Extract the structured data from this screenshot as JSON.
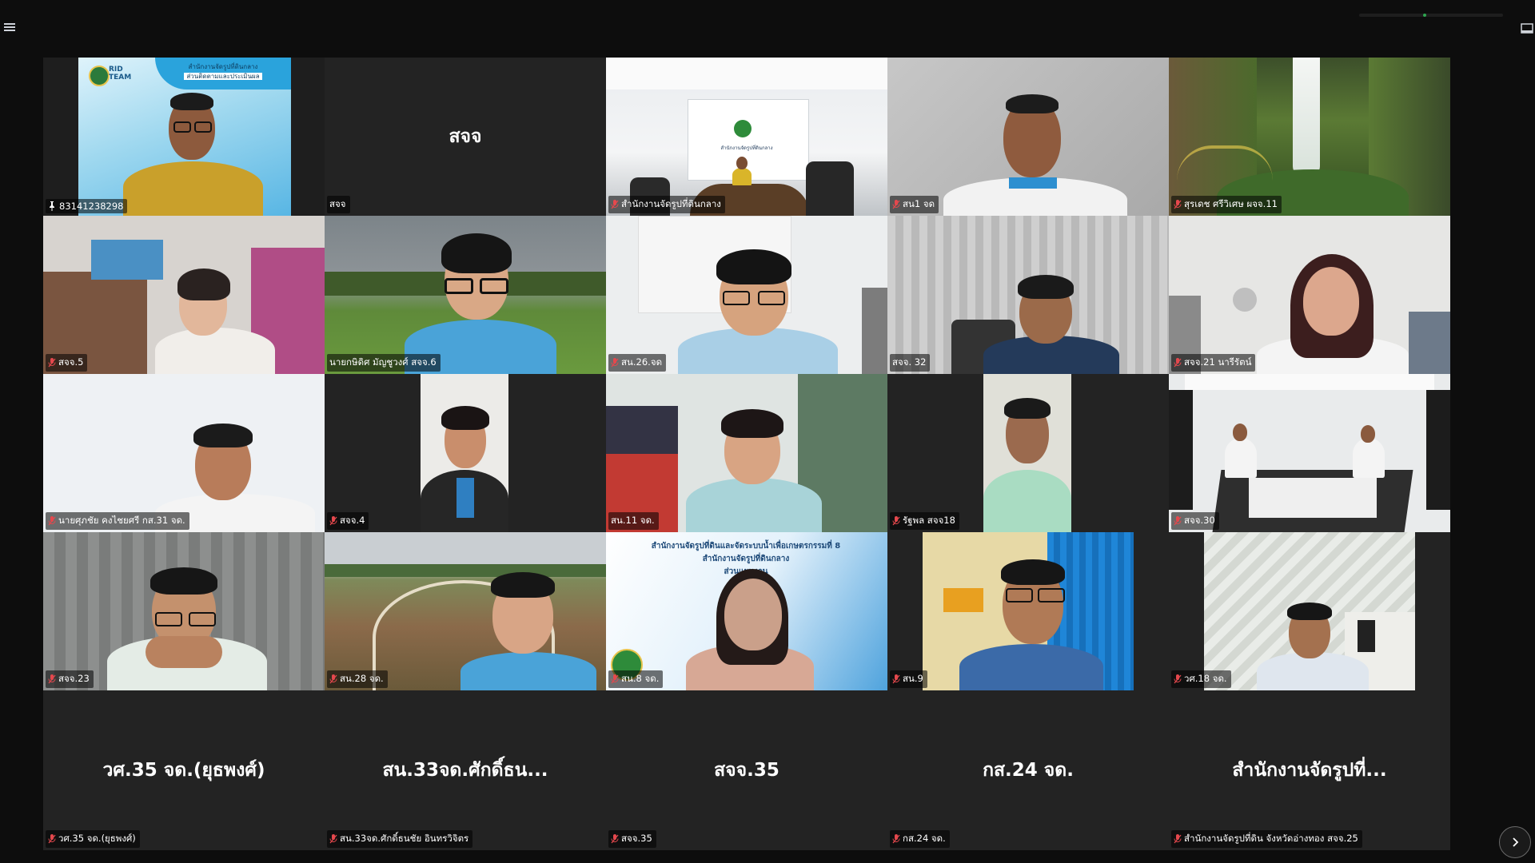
{
  "toolbar": {
    "view_list_icon": "list-icon",
    "view_grid_icon": "grid-icon",
    "right_icon": "panel-icon"
  },
  "logo": {
    "line1": "RID",
    "line2": "TEAM"
  },
  "banner": {
    "line1": "สำนักงานจัดรูปที่ดินกลาง",
    "line2": "ส่วนติดตามและประเมินผล"
  },
  "slide": {
    "line1": "สำนักงานจัดรูปที่ดินและจัดระบบน้ำเพื่อเกษตรกรรมที่ 8",
    "line2": "สำนักงานจัดรูปที่ดินกลาง",
    "line3": "ส่วนแผนงาน"
  },
  "room_sign": "สำนักงานจัดรูปที่ดินกลาง",
  "participants": [
    {
      "name": "83141238298",
      "pinned": true,
      "muted": false
    },
    {
      "name": "สจจ",
      "center": "สจจ",
      "muted": false
    },
    {
      "name": "สำนักงานจัดรูปที่ดินกลาง",
      "muted": true
    },
    {
      "name": "สน1 จด",
      "muted": true
    },
    {
      "name": "สุรเดช ศรีวิเศษ ผจจ.11",
      "muted": true
    },
    {
      "name": "สจจ.5",
      "muted": true
    },
    {
      "name": "นายกษิดิศ มัญชูวงศ์ สจจ.6",
      "muted": false
    },
    {
      "name": "สน.26.จด",
      "muted": true
    },
    {
      "name": "สจจ. 32",
      "muted": false
    },
    {
      "name": "สจจ.21 นารีรัตน์",
      "muted": true
    },
    {
      "name": "นายศุภชัย คงไชยศรี กส.31 จด.",
      "muted": true
    },
    {
      "name": "สจจ.4",
      "muted": true
    },
    {
      "name": "สน.11 จด.",
      "muted": false
    },
    {
      "name": "รัฐพล สจจ18",
      "muted": true
    },
    {
      "name": "สจจ.30",
      "muted": true
    },
    {
      "name": "สจจ.23",
      "muted": true
    },
    {
      "name": "สน.28 จด.",
      "muted": true
    },
    {
      "name": "สน.8 จด.",
      "muted": true
    },
    {
      "name": "สน.9",
      "muted": true
    },
    {
      "name": "วศ.18 จด.",
      "muted": true
    },
    {
      "name": "วศ.35 จด.(ยุธพงศ์)",
      "center": "วศ.35 จด.(ยุธพงศ์)",
      "muted": true
    },
    {
      "name": "สน.33จด.ศักดิ์ธนชัย อินทรวิจิตร",
      "center": "สน.33จด.ศักดิ์ธน...",
      "muted": true
    },
    {
      "name": "สจจ.35",
      "center": "สจจ.35",
      "muted": true
    },
    {
      "name": "กส.24 จด.",
      "center": "กส.24 จด.",
      "muted": true
    },
    {
      "name": "สำนักงานจัดรูปที่ดิน จังหวัดอ่างทอง สจจ.25",
      "center": "สำนักงานจัดรูปที่...",
      "muted": true
    }
  ],
  "next_page_icon": "chevron-right-icon",
  "colors": {
    "active_border": "#23d18b",
    "mute_red": "#e5484d",
    "tile_bg": "#232323"
  }
}
